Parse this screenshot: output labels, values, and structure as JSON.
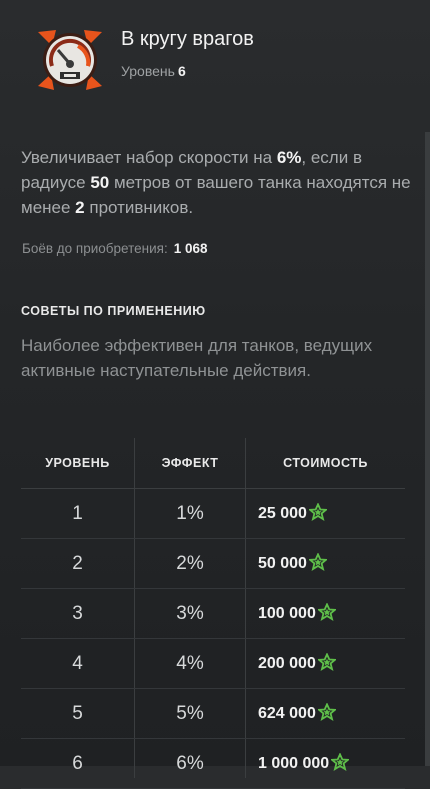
{
  "skill": {
    "title": "В кругу врагов",
    "level_label": "Уровень",
    "level_value": "6",
    "icon": "speedometer-skill-icon"
  },
  "description": {
    "p1": "Увеличивает набор скорости на ",
    "v1": "6%",
    "p2": ", если в радиусе ",
    "v2": "50",
    "p3": " метров от вашего танка находятся не менее ",
    "v3": "2",
    "p4": " противников."
  },
  "battles": {
    "label": "Боёв до приобретения:",
    "value": "1 068"
  },
  "tips": {
    "heading": "СОВЕТЫ ПО ПРИМЕНЕНИЮ",
    "text": "Наиболее эффективен для танков, ведущих активные наступательные действия."
  },
  "table": {
    "headers": [
      "УРОВЕНЬ",
      "ЭФФЕКТ",
      "СТОИМОСТЬ"
    ],
    "rows": [
      {
        "level": "1",
        "effect": "1%",
        "cost": "25 000"
      },
      {
        "level": "2",
        "effect": "2%",
        "cost": "50 000"
      },
      {
        "level": "3",
        "effect": "3%",
        "cost": "100 000"
      },
      {
        "level": "4",
        "effect": "4%",
        "cost": "200 000"
      },
      {
        "level": "5",
        "effect": "5%",
        "cost": "624 000"
      },
      {
        "level": "6",
        "effect": "6%",
        "cost": "1 000 000"
      }
    ],
    "currency_icon": "experience-star-icon"
  },
  "colors": {
    "background": "#26282a",
    "accent_orange": "#e8541c",
    "star_green": "#5fbf4a"
  }
}
